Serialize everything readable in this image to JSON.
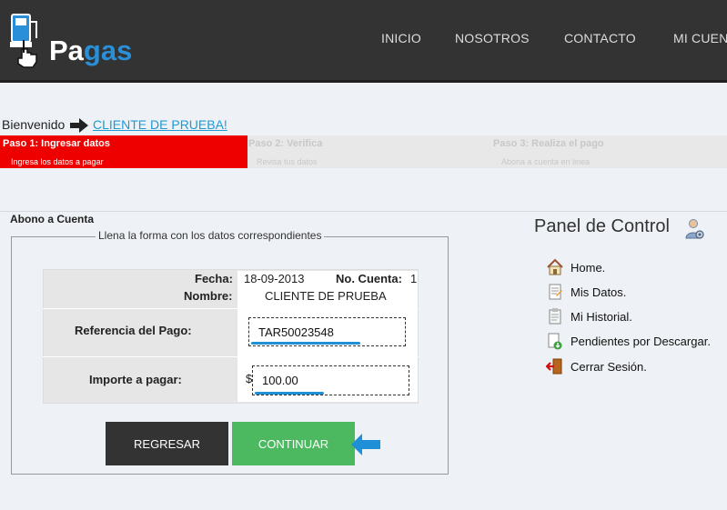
{
  "header": {
    "logo_text_main": "Pa",
    "logo_text_accent": "gas",
    "nav": [
      "INICIO",
      "NOSOTROS",
      "CONTACTO",
      "MI CUENTA"
    ]
  },
  "welcome": {
    "label": "Bienvenido",
    "client_link": "CLIENTE DE PRUEBA!"
  },
  "steps": [
    {
      "title": "Paso 1: Ingresar datos",
      "subtitle": "Ingresa los datos a pagar",
      "active": true
    },
    {
      "title": "Paso 2: Verifica",
      "subtitle": "Revisa tus datos",
      "active": false
    },
    {
      "title": "Paso 3: Realiza el pago",
      "subtitle": "Abona a cuenta en linea",
      "active": false
    }
  ],
  "form": {
    "section_title": "Abono a Cuenta",
    "legend": "Llena la forma con los datos correspondientes",
    "fecha_label": "Fecha:",
    "fecha_value": "18-09-2013",
    "cuenta_label": "No. Cuenta:",
    "cuenta_value": "1",
    "nombre_label": "Nombre:",
    "nombre_value": "CLIENTE DE PRUEBA",
    "referencia_label": "Referencia del Pago:",
    "referencia_value": "TAR50023548",
    "importe_label": "Importe a pagar:",
    "currency_symbol": "$",
    "importe_value": "100.00",
    "back_button": "REGRESAR",
    "continue_button": "CONTINUAR"
  },
  "panel": {
    "title": "Panel de Control",
    "items": [
      {
        "label": "Home.",
        "icon": "home-icon"
      },
      {
        "label": "Mis Datos.",
        "icon": "document-icon"
      },
      {
        "label": "Mi Historial.",
        "icon": "history-icon"
      },
      {
        "label": "Pendientes por Descargar.",
        "icon": "download-icon"
      },
      {
        "label": "Cerrar Sesión.",
        "icon": "logout-icon"
      }
    ]
  },
  "colors": {
    "header_bg": "#333333",
    "active_step": "#ee0000",
    "continue_green": "#4cb860",
    "link_blue": "#1e9ad6",
    "annotation_blue": "#1f8fd6"
  }
}
